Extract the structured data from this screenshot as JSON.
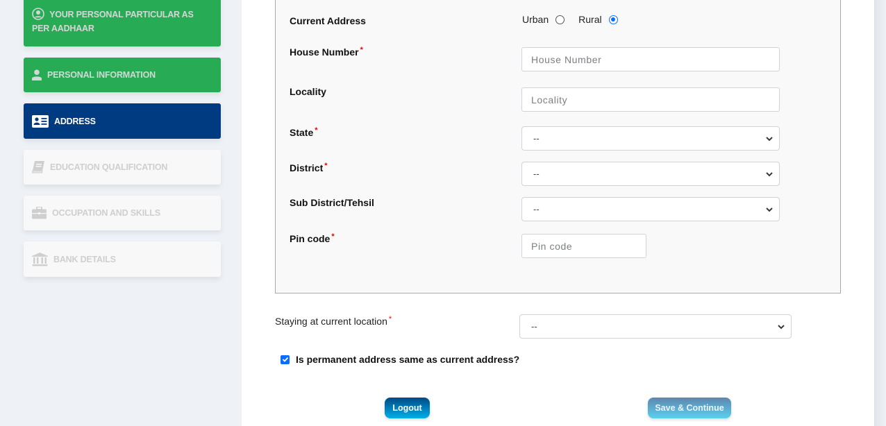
{
  "sidebar": {
    "steps": [
      {
        "label": "YOUR PERSONAL PARTICULAR AS PER AADHAAR",
        "icon": "user-circle-icon",
        "status": "completed"
      },
      {
        "label": "PERSONAL INFORMATION",
        "icon": "user-icon",
        "status": "completed"
      },
      {
        "label": "ADDRESS",
        "icon": "address-card-icon",
        "status": "active"
      },
      {
        "label": "EDUCATION QUALIFICATION",
        "icon": "book-icon",
        "status": "pending"
      },
      {
        "label": "OCCUPATION AND SKILLS",
        "icon": "briefcase-icon",
        "status": "pending"
      },
      {
        "label": "BANK DETAILS",
        "icon": "bank-icon",
        "status": "pending"
      }
    ]
  },
  "form": {
    "current_address": {
      "label": "Current Address",
      "options": [
        "Urban",
        "Rural"
      ],
      "selected": "Rural"
    },
    "house_number": {
      "label": "House Number",
      "required": "*",
      "placeholder": "House Number",
      "value": ""
    },
    "locality": {
      "label": "Locality",
      "placeholder": "Locality",
      "value": ""
    },
    "state": {
      "label": "State",
      "required": "*",
      "value": "--"
    },
    "district": {
      "label": "District",
      "required": "*",
      "value": "--"
    },
    "sub_district": {
      "label": "Sub District/Tehsil",
      "value": "--"
    },
    "pin_code": {
      "label": "Pin code",
      "required": "*",
      "placeholder": "Pin code",
      "value": ""
    },
    "staying": {
      "label": "Staying at current location",
      "required": "*",
      "value": "--"
    },
    "permanent_same": {
      "label": "Is permanent address same as current address?",
      "checked": true
    }
  },
  "buttons": {
    "logout": "Logout",
    "save_continue": "Save & Continue"
  },
  "colors": {
    "completed": "#27ab55",
    "active": "#003a80",
    "pending": "#f8f8f8",
    "accent": "#0b6cff"
  }
}
